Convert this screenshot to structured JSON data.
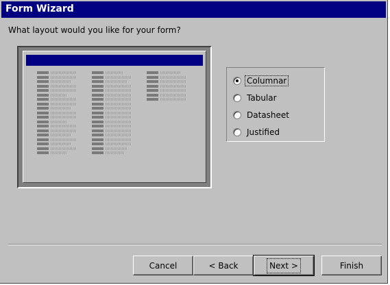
{
  "window": {
    "title": "Form Wizard"
  },
  "prompt": "What layout would you like for your form?",
  "layout_options": [
    {
      "label": "Columnar",
      "checked": true
    },
    {
      "label": "Tabular",
      "checked": false
    },
    {
      "label": "Datasheet",
      "checked": false
    },
    {
      "label": "Justified",
      "checked": false
    }
  ],
  "buttons": {
    "cancel": "Cancel",
    "back": "< Back",
    "next": "Next >",
    "finish": "Finish"
  },
  "colors": {
    "title_bar": "#000080",
    "dialog_face": "#c0c0c0"
  },
  "icons": [
    "radio-checked-icon",
    "radio-unchecked-icon"
  ]
}
